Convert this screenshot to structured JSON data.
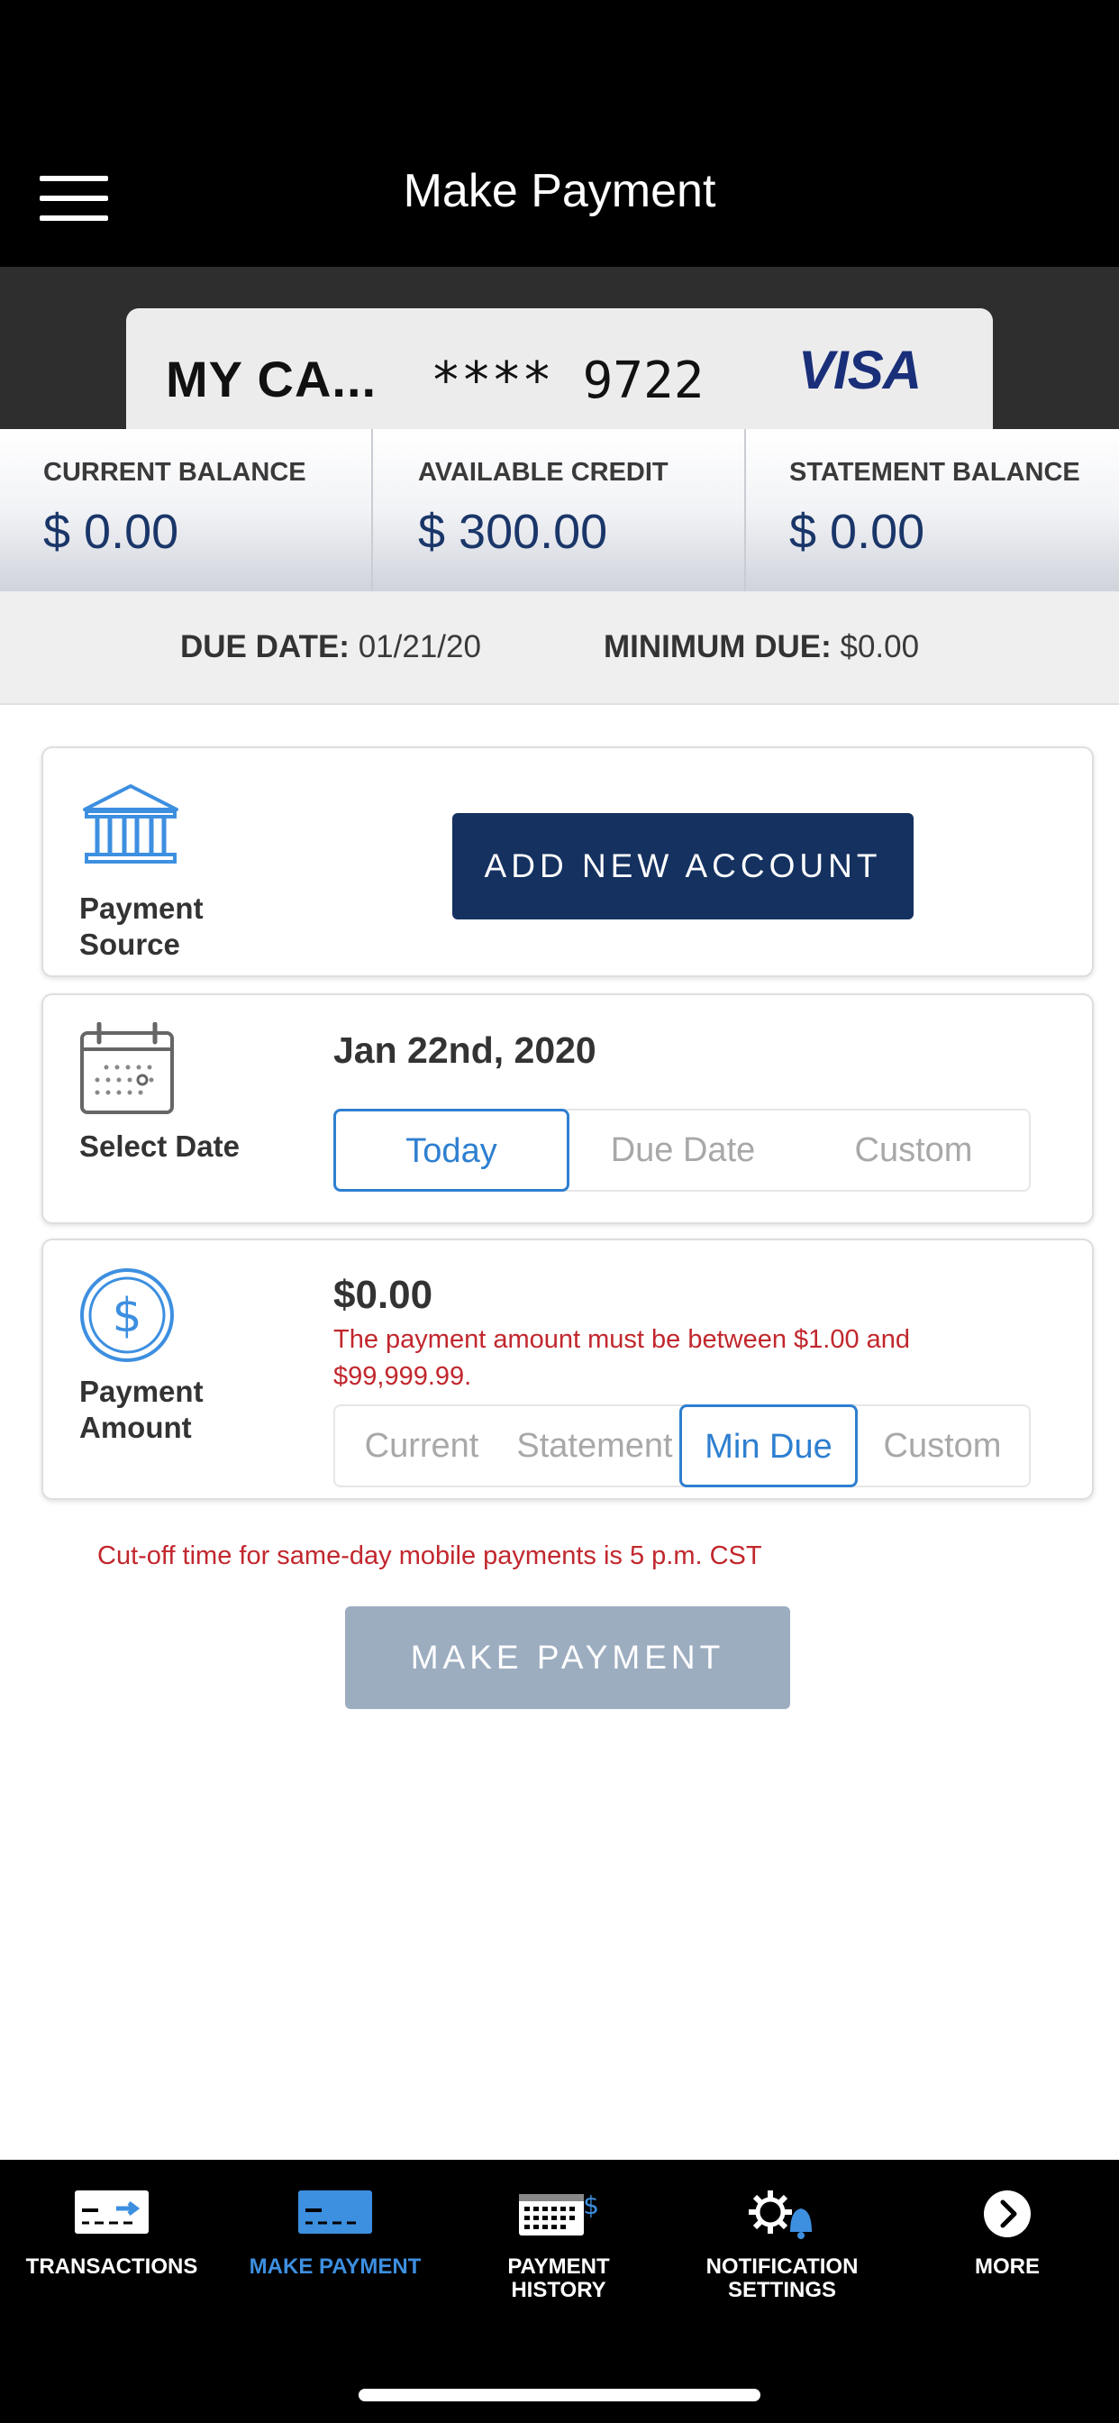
{
  "header": {
    "title": "Make Payment",
    "menu_icon": "hamburger-icon"
  },
  "card": {
    "name": "MY CA...",
    "number_masked": "**** 9722",
    "brand": "VISA"
  },
  "balances": [
    {
      "label": "CURRENT BALANCE",
      "value": "$ 0.00"
    },
    {
      "label": "AVAILABLE CREDIT",
      "value": "$ 300.00"
    },
    {
      "label": "STATEMENT BALANCE",
      "value": "$ 0.00"
    }
  ],
  "due": {
    "due_date_label": "DUE DATE:",
    "due_date": "01/21/20",
    "min_due_label": "MINIMUM DUE:",
    "min_due": "$0.00"
  },
  "payment_source": {
    "label_line1": "Payment",
    "label_line2": "Source",
    "icon": "bank-icon",
    "button": "ADD NEW ACCOUNT"
  },
  "select_date": {
    "label": "Select Date",
    "icon": "calendar-icon",
    "date": "Jan 22nd, 2020",
    "options": [
      "Today",
      "Due Date",
      "Custom"
    ],
    "selected": "Today"
  },
  "payment_amount": {
    "label_line1": "Payment",
    "label_line2": "Amount",
    "icon": "dollar-icon",
    "value": "$0.00",
    "error": "The payment amount must be between $1.00 and $99,999.99.",
    "options": [
      "Current",
      "Statement",
      "Min Due",
      "Custom"
    ],
    "selected": "Min Due"
  },
  "cutoff_notice": "Cut-off time for same-day mobile payments is 5 p.m. CST",
  "make_payment_button": "MAKE PAYMENT",
  "nav": {
    "items": [
      {
        "label": "TRANSACTIONS",
        "icon": "transactions-icon"
      },
      {
        "label": "MAKE PAYMENT",
        "icon": "make-payment-icon"
      },
      {
        "label_line1": "PAYMENT",
        "label_line2": "HISTORY",
        "icon": "payment-history-icon"
      },
      {
        "label_line1": "NOTIFICATION",
        "label_line2": "SETTINGS",
        "icon": "notification-settings-icon"
      },
      {
        "label": "MORE",
        "icon": "chevron-right-icon"
      }
    ],
    "active": "MAKE PAYMENT"
  },
  "colors": {
    "navy": "#143160",
    "accent_blue": "#2e7fd0",
    "error_red": "#c1272d",
    "disabled_button": "#9dadc0"
  }
}
